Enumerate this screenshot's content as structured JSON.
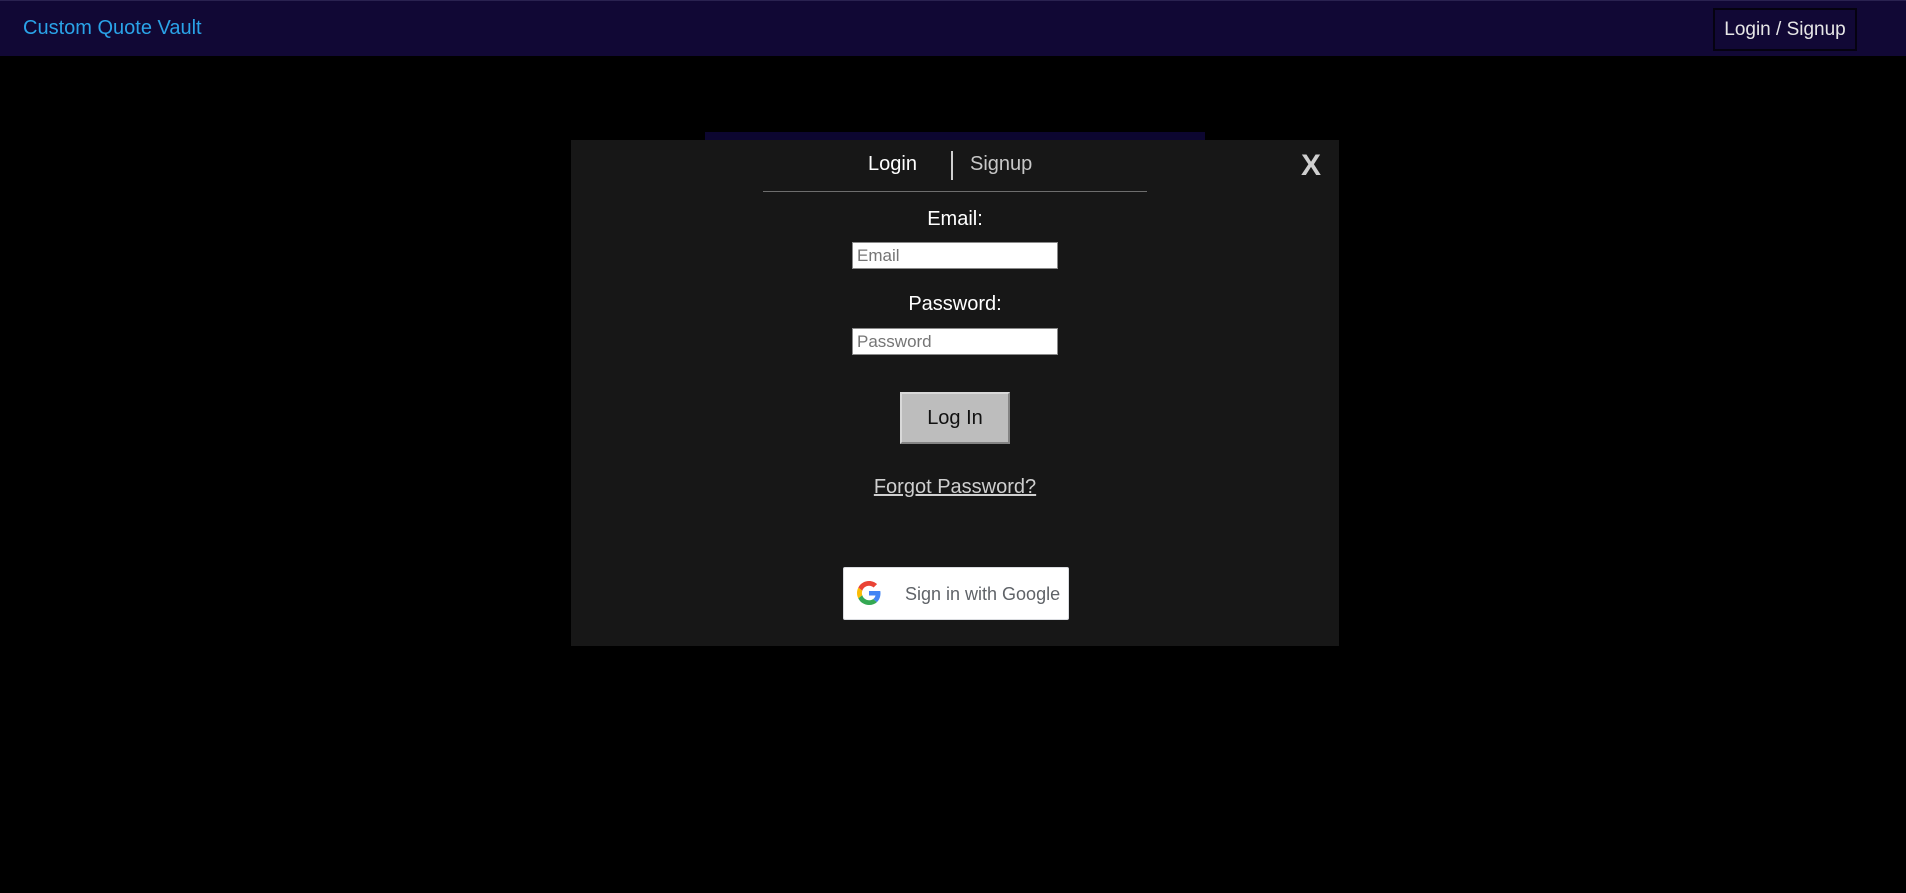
{
  "navbar": {
    "brand": "Custom Quote Vault",
    "login_signup_label": "Login / Signup"
  },
  "modal": {
    "tabs": [
      {
        "label": "Login",
        "active": true
      },
      {
        "label": "Signup",
        "active": false
      }
    ],
    "close_label": "X",
    "email": {
      "label": "Email:",
      "placeholder": "Email",
      "value": ""
    },
    "password": {
      "label": "Password:",
      "placeholder": "Password",
      "value": ""
    },
    "login_button_label": "Log In",
    "forgot_password_label": "Forgot Password?",
    "google_button_label": "Sign in with Google",
    "google_icon": "google-g-icon"
  },
  "colors": {
    "navbar_bg": "#110835",
    "brand": "#2aa3e8",
    "page_bg": "#000000",
    "modal_bg": "#171717"
  }
}
